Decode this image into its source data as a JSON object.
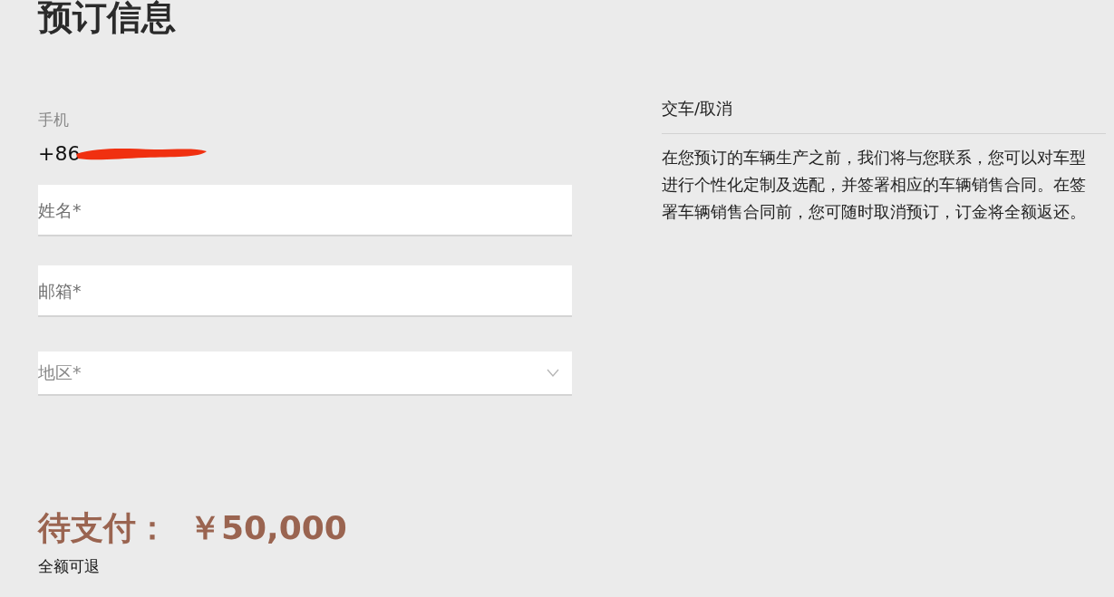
{
  "title": "预订信息",
  "phone": {
    "label": "手机",
    "value": "+86"
  },
  "fields": [
    {
      "kind": "text",
      "placeholder": "姓名*"
    },
    {
      "kind": "text",
      "placeholder": "邮箱*"
    },
    {
      "kind": "select",
      "placeholder": "地区*"
    }
  ],
  "info": {
    "heading": "交车/取消",
    "body": "在您预订的车辆生产之前，我们将与您联系，您可以对车型进行个性化定制及选配，并签署相应的车辆销售合同。在签署车辆销售合同前，您可随时取消预订，订金将全额返还。"
  },
  "payment": {
    "label": "待支付：",
    "amount": "￥50,000",
    "note": "全额可退"
  }
}
